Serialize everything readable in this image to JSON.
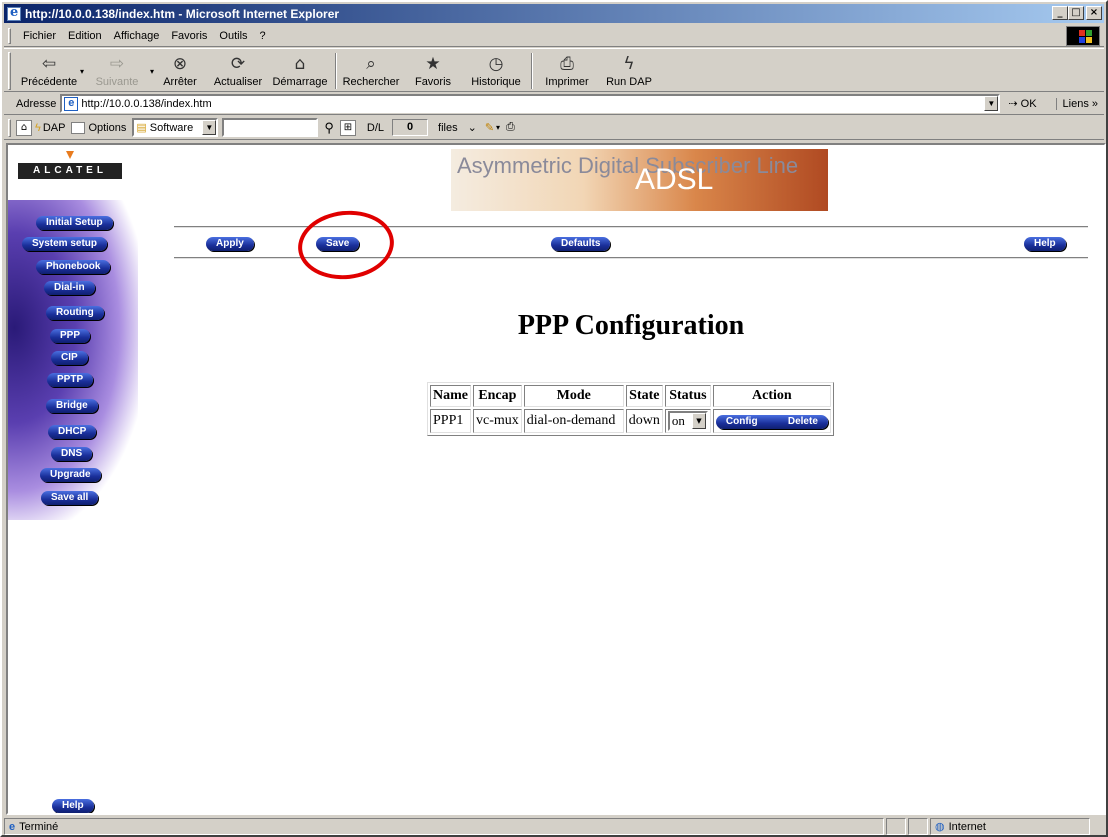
{
  "window": {
    "title": "http://10.0.0.138/index.htm - Microsoft Internet Explorer",
    "buttons": {
      "minimize": "_",
      "maximize": "□",
      "close": "×"
    }
  },
  "menubar": {
    "items": [
      {
        "label": "Fichier"
      },
      {
        "label": "Edition"
      },
      {
        "label": "Affichage"
      },
      {
        "label": "Favoris"
      },
      {
        "label": "Outils"
      },
      {
        "label": "?"
      }
    ]
  },
  "toolbar": {
    "buttons": [
      {
        "label": "Précédente",
        "icon": "back-arrow-icon",
        "glyph": "⇦",
        "disabled": false
      },
      {
        "label": "Suivante",
        "icon": "forward-arrow-icon",
        "glyph": "⇨",
        "disabled": true
      },
      {
        "label": "Arrêter",
        "icon": "stop-icon",
        "glyph": "⊗",
        "disabled": false
      },
      {
        "label": "Actualiser",
        "icon": "refresh-icon",
        "glyph": "⟳",
        "disabled": false
      },
      {
        "label": "Démarrage",
        "icon": "home-icon",
        "glyph": "⌂",
        "disabled": false
      },
      {
        "label": "Rechercher",
        "icon": "search-icon",
        "glyph": "⌕",
        "disabled": false
      },
      {
        "label": "Favoris",
        "icon": "favorites-icon",
        "glyph": "★",
        "disabled": false
      },
      {
        "label": "Historique",
        "icon": "history-icon",
        "glyph": "◷",
        "disabled": false
      },
      {
        "label": "Imprimer",
        "icon": "print-icon",
        "glyph": "⎙",
        "disabled": false
      },
      {
        "label": "Run DAP",
        "icon": "lightning-icon",
        "glyph": "ϟ",
        "disabled": false
      }
    ]
  },
  "addressbar": {
    "label": "Adresse",
    "url": "http://10.0.0.138/index.htm",
    "go_label": "OK",
    "links_label": "Liens"
  },
  "dapbar": {
    "dap_label": "DAP",
    "options_label": "Options",
    "category_value": "Software",
    "search_value": "",
    "dl_label": "D/L",
    "dl_count": "0",
    "files_label": "files"
  },
  "page": {
    "logo_text": "ALCATEL",
    "banner_text": "Asymmetric Digital Subscriber Line",
    "banner_adsl": "ADSL",
    "title": "PPP Configuration",
    "top_buttons": {
      "apply": "Apply",
      "save": "Save",
      "defaults": "Defaults",
      "help": "Help"
    },
    "nav": [
      {
        "label": "Initial Setup"
      },
      {
        "label": "System setup"
      },
      {
        "label": "Phonebook"
      },
      {
        "label": "Dial-in"
      },
      {
        "label": "Routing"
      },
      {
        "label": "PPP"
      },
      {
        "label": "CIP"
      },
      {
        "label": "PPTP"
      },
      {
        "label": "Bridge"
      },
      {
        "label": "DHCP"
      },
      {
        "label": "DNS"
      },
      {
        "label": "Upgrade"
      },
      {
        "label": "Save all"
      }
    ],
    "nav_help": "Help",
    "table": {
      "headers": [
        "Name",
        "Encap",
        "Mode",
        "State",
        "Status",
        "Action"
      ],
      "rows": [
        {
          "name": "PPP1",
          "encap": "vc-mux",
          "mode": "dial-on-demand",
          "state": "down",
          "status": "on",
          "config": "Config",
          "delete": "Delete"
        }
      ]
    },
    "annotation_color": "#e00000"
  },
  "statusbar": {
    "text": "Terminé",
    "zone": "Internet"
  }
}
